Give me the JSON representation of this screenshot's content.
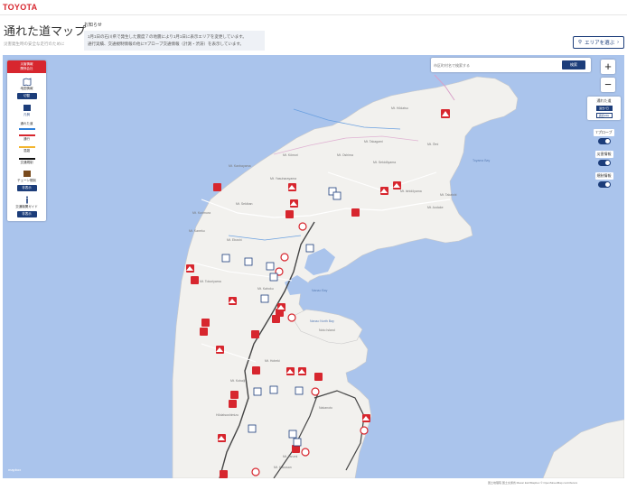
{
  "header": {
    "logo": "TOYOTA"
  },
  "page": {
    "title": "通れた道マップ",
    "subtitle": "災害発生時の安全な走行のために"
  },
  "notice": {
    "label": "お知らせ",
    "lines": [
      "1月1日の石川県で発生した震度７の地震により1月1日に表示エリアを変更しています。",
      "通行実績、交通規制情報の他にTプローブ交通情報（計測・渋滞）を表示しています。"
    ]
  },
  "area_button": {
    "label": "エリアを選ぶ"
  },
  "search": {
    "placeholder": "市区町村名で検索する",
    "button": "検索"
  },
  "legend": {
    "header": "災害情報\n関係会社",
    "items": [
      {
        "label": "地図情報",
        "button": "切替",
        "icon": "map-icon"
      },
      {
        "label": "凡例",
        "icon": "legend-icon"
      },
      {
        "label": "通れた道",
        "color": "#2e7fd9"
      },
      {
        "label": "通行",
        "color": "#d7262e"
      },
      {
        "label": "混雑",
        "color": "#f3b52e"
      },
      {
        "label": "交通規制",
        "color": "#111111"
      },
      {
        "label": "チェーン規制",
        "button": "非表示",
        "icon": "chain-icon"
      },
      {
        "label": "交通機関ガイド",
        "button": "非表示",
        "icon": "info-icon"
      }
    ]
  },
  "zoom": {
    "in": "+",
    "out": "−"
  },
  "right_panel": {
    "passed_roads": {
      "label": "通れた道",
      "btn1": "過去7日",
      "btn2": "過去24H"
    },
    "tprobe": {
      "label": "Tプローブ"
    },
    "disaster": {
      "label": "災害情報"
    },
    "regulation": {
      "label": "規制情報"
    }
  },
  "map_labels": [
    "Mt. Hōdatsu",
    "Mt. Kanbayama",
    "Mt. Kōmori",
    "Mt. Takagami",
    "Mt. Sekiban",
    "Mt. Kurimura",
    "Mt. Yasuharayama",
    "Mt. Eboshi",
    "Mt. Tokuriyama",
    "Mt. Kahoku",
    "Nanao Bay",
    "Nanao North Bay",
    "Noto Island",
    "Mt. Ōmi",
    "Nakanoto",
    "Mt. Sekidōyama",
    "Mt. Ishidōyama",
    "Toyama Bay",
    "Mt. Aodake",
    "Mt. Kaneku",
    "Mt. Oshima",
    "Hōdatsushimizu",
    "Mt. Hoheki",
    "Mt. Kobaiji",
    "Mt. Tarumi",
    "Mt. Takaishi",
    "Mt. Hakusan"
  ],
  "copyright": "国土地理院 国土交通省 Maxar Esri/Mapbox © OpenStreetMap contributors",
  "mapbox": "mapbox",
  "colors": {
    "brand": "#d7262e",
    "accent": "#1c3d7a",
    "water": "#aac4ec",
    "land": "#f2f1ee"
  }
}
